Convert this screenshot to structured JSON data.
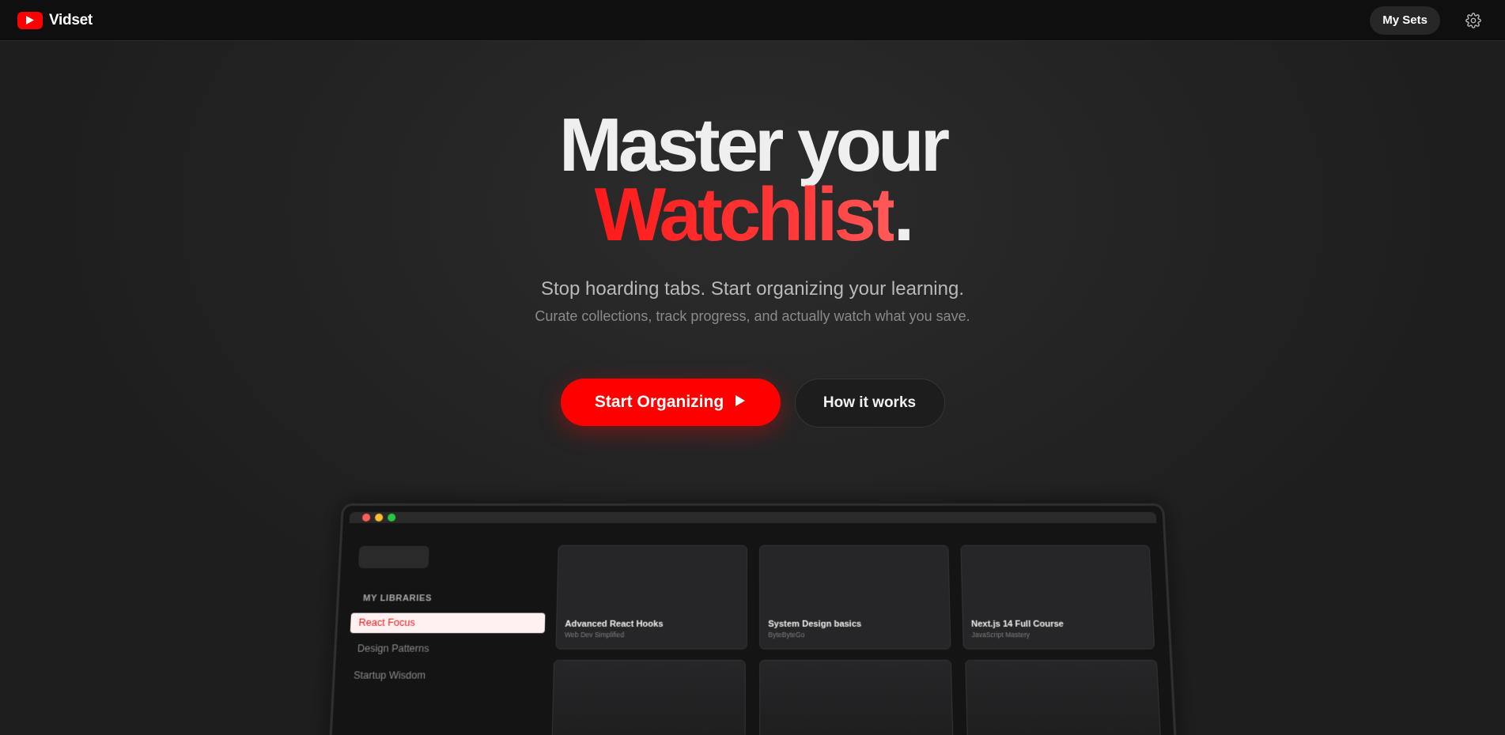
{
  "nav": {
    "brand": "Vidset",
    "my_sets_label": "My Sets",
    "logo_icon": "youtube-play-icon",
    "settings_icon": "gear-icon",
    "accent_color": "#ff0000"
  },
  "hero": {
    "headline_line1": "Master your",
    "headline_highlight": "Watchlist",
    "headline_punct": ".",
    "subtitle": "Stop hoarding tabs. Start organizing your learning.",
    "description": "Curate collections, track progress, and actually watch what you save."
  },
  "cta": {
    "primary_label": "Start Organizing",
    "primary_icon": "play-icon",
    "secondary_label": "How it works"
  },
  "preview": {
    "window_controls": [
      "close",
      "minimize",
      "maximize"
    ],
    "libraries_title": "MY LIBRARIES",
    "libraries": [
      {
        "label": "React Focus",
        "active": true
      },
      {
        "label": "Design Patterns",
        "active": false
      },
      {
        "label": "Startup Wisdom",
        "active": false
      }
    ],
    "cards": [
      {
        "title": "Advanced React Hooks",
        "channel": "Web Dev Simplified"
      },
      {
        "title": "System Design basics",
        "channel": "ByteByteGo"
      },
      {
        "title": "Next.js 14 Full Course",
        "channel": "JavaScript Mastery"
      }
    ]
  }
}
